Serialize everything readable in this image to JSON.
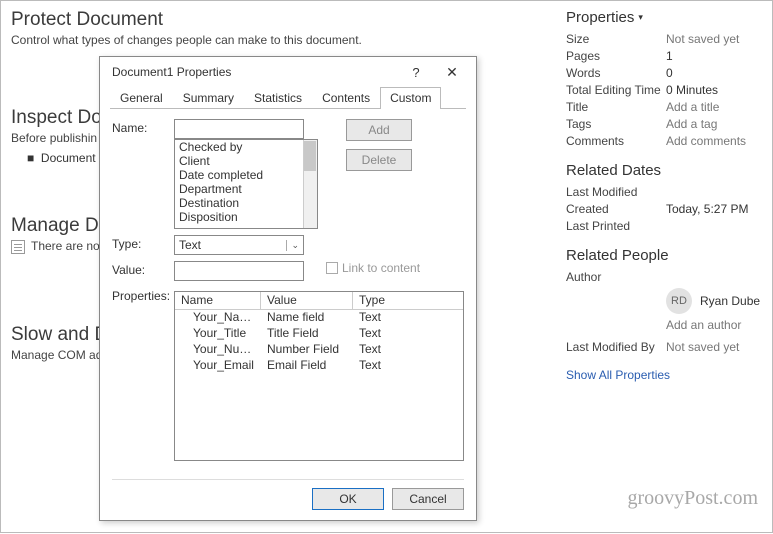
{
  "main": {
    "protect_title": "Protect Document",
    "protect_sub": "Control what types of changes people can make to this document.",
    "inspect_title": "Inspect Do",
    "inspect_sub": "Before publishin",
    "inspect_bullet": "Document p",
    "manage_title": "Manage D",
    "manage_sub": "There are no",
    "slow_title": "Slow and D",
    "slow_sub": "Manage COM ad"
  },
  "dialog": {
    "title": "Document1 Properties",
    "tabs": [
      "General",
      "Summary",
      "Statistics",
      "Contents",
      "Custom"
    ],
    "active_tab": "Custom",
    "labels": {
      "name": "Name:",
      "type": "Type:",
      "value": "Value:",
      "props": "Properties:"
    },
    "add_btn": "Add",
    "del_btn": "Delete",
    "suggestions": [
      "Checked by",
      "Client",
      "Date completed",
      "Department",
      "Destination",
      "Disposition"
    ],
    "type_value": "Text",
    "link_label": "Link to content",
    "grid_headers": [
      "Name",
      "Value",
      "Type"
    ],
    "grid_rows": [
      {
        "n": "Your_Name",
        "v": "Name field",
        "t": "Text"
      },
      {
        "n": "Your_Title",
        "v": "Title Field",
        "t": "Text"
      },
      {
        "n": "Your_Nu…",
        "v": "Number Field",
        "t": "Text"
      },
      {
        "n": "Your_Email",
        "v": "Email Field",
        "t": "Text"
      }
    ],
    "ok": "OK",
    "cancel": "Cancel"
  },
  "side": {
    "properties_label": "Properties",
    "rows1": [
      {
        "k": "Size",
        "v": "Not saved yet",
        "muted": true
      },
      {
        "k": "Pages",
        "v": "1"
      },
      {
        "k": "Words",
        "v": "0"
      },
      {
        "k": "Total Editing Time",
        "v": "0 Minutes"
      },
      {
        "k": "Title",
        "v": "Add a title",
        "muted": true
      },
      {
        "k": "Tags",
        "v": "Add a tag",
        "muted": true
      },
      {
        "k": "Comments",
        "v": "Add comments",
        "muted": true
      }
    ],
    "dates_title": "Related Dates",
    "dates": [
      {
        "k": "Last Modified",
        "v": ""
      },
      {
        "k": "Created",
        "v": "Today, 5:27 PM"
      },
      {
        "k": "Last Printed",
        "v": ""
      }
    ],
    "people_title": "Related People",
    "author_label": "Author",
    "author_initials": "RD",
    "author_name": "Ryan Dube",
    "add_author": "Add an author",
    "lastmod_label": "Last Modified By",
    "lastmod_value": "Not saved yet",
    "show_all": "Show All Properties",
    "watermark": "groovyPost.com"
  }
}
